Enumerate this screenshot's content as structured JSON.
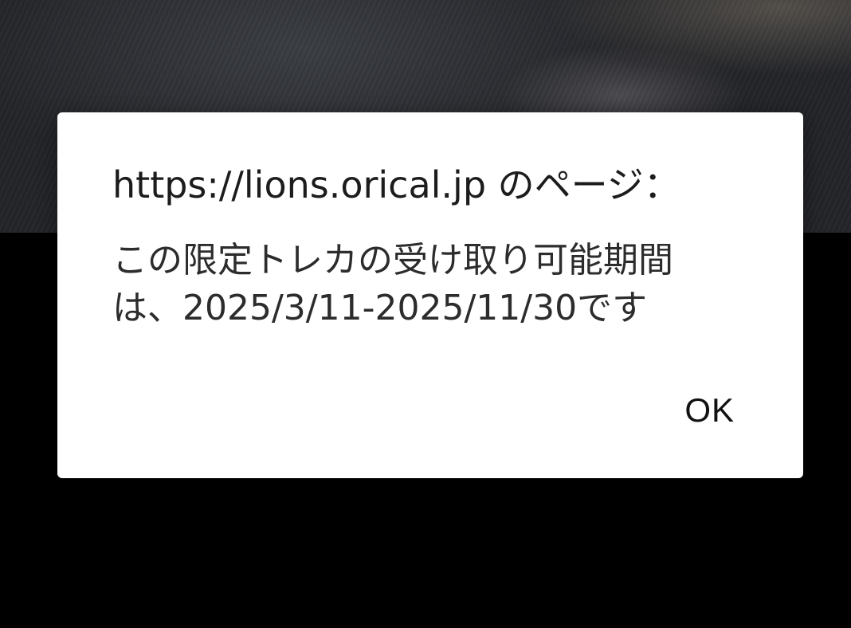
{
  "dialog": {
    "title": "https://lions.orical.jp のページ：",
    "message": "この限定トレカの受け取り可能期間は、2025/3/11-2025/11/30です",
    "ok_label": "OK"
  }
}
